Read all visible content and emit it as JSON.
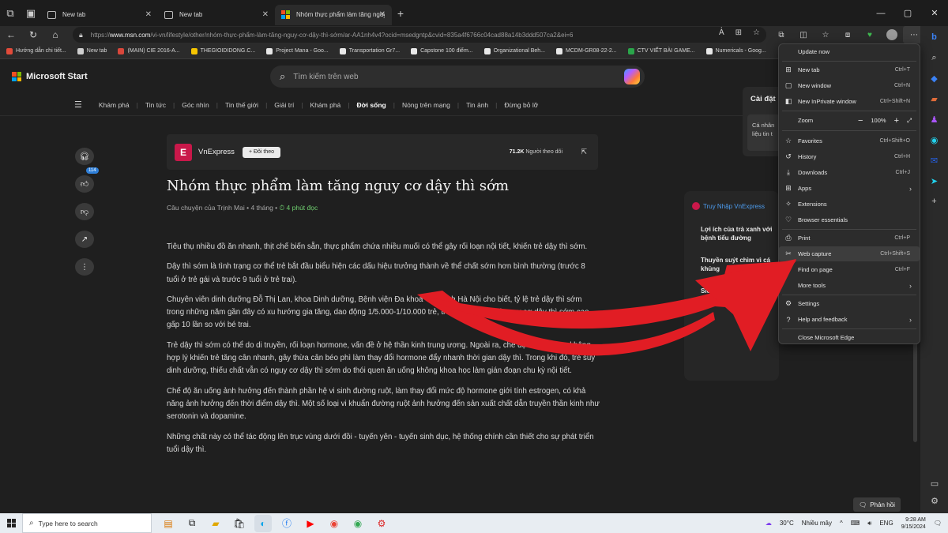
{
  "tabs": [
    {
      "label": "New tab",
      "active": false
    },
    {
      "label": "New tab",
      "active": false
    },
    {
      "label": "Nhóm thực phẩm làm tăng nguy",
      "active": true
    }
  ],
  "address": {
    "prefix": "https://",
    "host": "www.msn.com",
    "path": "/vi-vn/lifestyle/other/nhóm-thực-phẩm-làm-tăng-nguy-cơ-dậy-thì-sớm/ar-AA1nh4v4?ocid=msedgntp&cvid=835a4f6766c04cad88a14b3ddd507ca2&ei=6"
  },
  "bookmarks": [
    {
      "label": "Hướng dẫn chi tiết...",
      "color": "#e24b3a"
    },
    {
      "label": "New tab",
      "color": "#cfcfcf"
    },
    {
      "label": "(MAIN) CIE 2016-A...",
      "color": "#d9473b"
    },
    {
      "label": "THEGIOIDIDONG.C...",
      "color": "#f5c400"
    },
    {
      "label": "Project Mana - Goo...",
      "color": "#e8e8e8"
    },
    {
      "label": "Transportation Gr7...",
      "color": "#e8e8e8"
    },
    {
      "label": "Capstone 100 điểm...",
      "color": "#e8e8e8"
    },
    {
      "label": "Organizational Beh...",
      "color": "#e8e8e8"
    },
    {
      "label": "MCDM-GR08-22-2...",
      "color": "#e8e8e8"
    },
    {
      "label": "CTV VIẾT BÀI GAME...",
      "color": "#2aa54a"
    },
    {
      "label": "Numericals - Goog...",
      "color": "#e8e8e8"
    }
  ],
  "msn": {
    "brand": "Microsoft Start",
    "search_placeholder": "Tìm kiếm trên web",
    "nav": [
      "Khám phá",
      "Tin tức",
      "Góc nhìn",
      "Tin thế giới",
      "Giải trí",
      "Khám phá",
      "Đời sống",
      "Nóng trên mạng",
      "Tin ảnh",
      "Đừng bỏ lỡ"
    ],
    "nav_active_index": 6,
    "like_count": "114"
  },
  "article": {
    "publisher": "VnExpress",
    "follow_label": "+ Đõi theo",
    "followers_count": "71.2K",
    "followers_label": "Người theo dõi",
    "title": "Nhóm thực phẩm làm tăng nguy cơ dậy thì sớm",
    "byline": "Câu chuyện của Trịnh Mai • 4 tháng •",
    "read_time": "4 phút đọc",
    "paragraphs": [
      "Tiêu thụ nhiều đồ ăn nhanh, thịt chế biến sẵn, thực phẩm chứa nhiều muối có thể gây rối loạn nội tiết, khiến trẻ dậy thì sớm.",
      "Dậy thì sớm là tình trạng cơ thể trẻ bắt đầu biểu hiện các dấu hiệu trưởng thành về thể chất sớm hơn bình thường (trước 8 tuổi ở trẻ gái và trước 9 tuổi ở trẻ trai).",
      "Chuyên viên dinh dưỡng Đỗ Thị Lan, khoa Dinh dưỡng, Bệnh viện Đa khoa Tâm Anh Hà Nội cho biết, tỷ lệ trẻ dậy thì sớm trong những năm gần đây có xu hướng gia tăng, dao động 1/5.000-1/10.000 trẻ, trong đó bé gái có nguy cơ dậy thì sớm cao gấp 10 lần so với bé trai.",
      "Trẻ dậy thì sớm có thể do di truyền, rối loạn hormone, vấn đề ở hệ thần kinh trung ương. Ngoài ra, chế độ dinh dưỡng không hợp lý khiến trẻ tăng cân nhanh, gây thừa cân béo phì làm thay đổi hormone đẩy nhanh thời gian dậy thì. Trong khi đó, trẻ suy dinh dưỡng, thiếu chất vẫn có nguy cơ dậy thì sớm do thói quen ăn uống không khoa học làm gián đoạn chu kỳ nội tiết.",
      "Chế độ ăn uống ảnh hưởng đến thành phần hệ vi sinh đường ruột, làm thay đổi mức độ hormone giới tính estrogen, có khả năng ảnh hưởng đến thời điểm dậy thì. Một số loại vi khuẩn đường ruột ảnh hưởng đến sản xuất chất dẫn truyền thần kinh như serotonin và dopamine.",
      "Những chất này có thể tác động lên trục vùng dưới đồi - tuyến yên - tuyến sinh dục, hệ thống chính cần thiết cho sự phát triển tuổi dậy thì."
    ]
  },
  "right_panel": {
    "card_title": "Cài đặt",
    "card_body_1": "Cá nhân",
    "card_body_2": "liệu tin t",
    "access_title": "Truy Nhập VnExpress",
    "items": [
      "Lợi ích của trà xanh với bệnh tiểu đường",
      "Thuyền suýt chìm vì cá khủng",
      "Siêu Trái Đ"
    ]
  },
  "menu": {
    "update": "Update now",
    "items": [
      {
        "label": "New tab",
        "shortcut": "Ctrl+T",
        "icon": "⊞"
      },
      {
        "label": "New window",
        "shortcut": "Ctrl+N",
        "icon": "▢"
      },
      {
        "label": "New InPrivate window",
        "shortcut": "Ctrl+Shift+N",
        "icon": "◧"
      }
    ],
    "zoom_label": "Zoom",
    "zoom_value": "100%",
    "items2": [
      {
        "label": "Favorites",
        "shortcut": "Ctrl+Shift+O",
        "icon": "☆"
      },
      {
        "label": "History",
        "shortcut": "Ctrl+H",
        "icon": "↺"
      },
      {
        "label": "Downloads",
        "shortcut": "Ctrl+J",
        "icon": "⤓"
      },
      {
        "label": "Apps",
        "shortcut": "",
        "icon": "⊞",
        "submenu": true
      },
      {
        "label": "Extensions",
        "shortcut": "",
        "icon": "✧"
      },
      {
        "label": "Browser essentials",
        "shortcut": "",
        "icon": "♡"
      }
    ],
    "items3": [
      {
        "label": "Print",
        "shortcut": "Ctrl+P",
        "icon": "⎙"
      },
      {
        "label": "Web capture",
        "shortcut": "Ctrl+Shift+S",
        "icon": "✂",
        "highlighted": true
      },
      {
        "label": "Find on page",
        "shortcut": "Ctrl+F",
        "icon": "⌕"
      },
      {
        "label": "More tools",
        "shortcut": "",
        "icon": "",
        "submenu": true
      }
    ],
    "items4": [
      {
        "label": "Settings",
        "shortcut": "",
        "icon": "⚙"
      },
      {
        "label": "Help and feedback",
        "shortcut": "",
        "icon": "?",
        "submenu": true
      }
    ],
    "close": "Close Microsoft Edge"
  },
  "feedback_label": "Phản hồi",
  "taskbar": {
    "search_placeholder": "Type here to search",
    "weather": "30°C",
    "weather_desc": "Nhiều mây",
    "lang": "ENG",
    "time": "9:28 AM",
    "date": "9/15/2024"
  },
  "colors": {
    "accent_red": "#e11d24",
    "ms_red": "#f25022",
    "ms_green": "#7fba00",
    "ms_blue": "#00a4ef",
    "ms_yellow": "#ffb900"
  }
}
